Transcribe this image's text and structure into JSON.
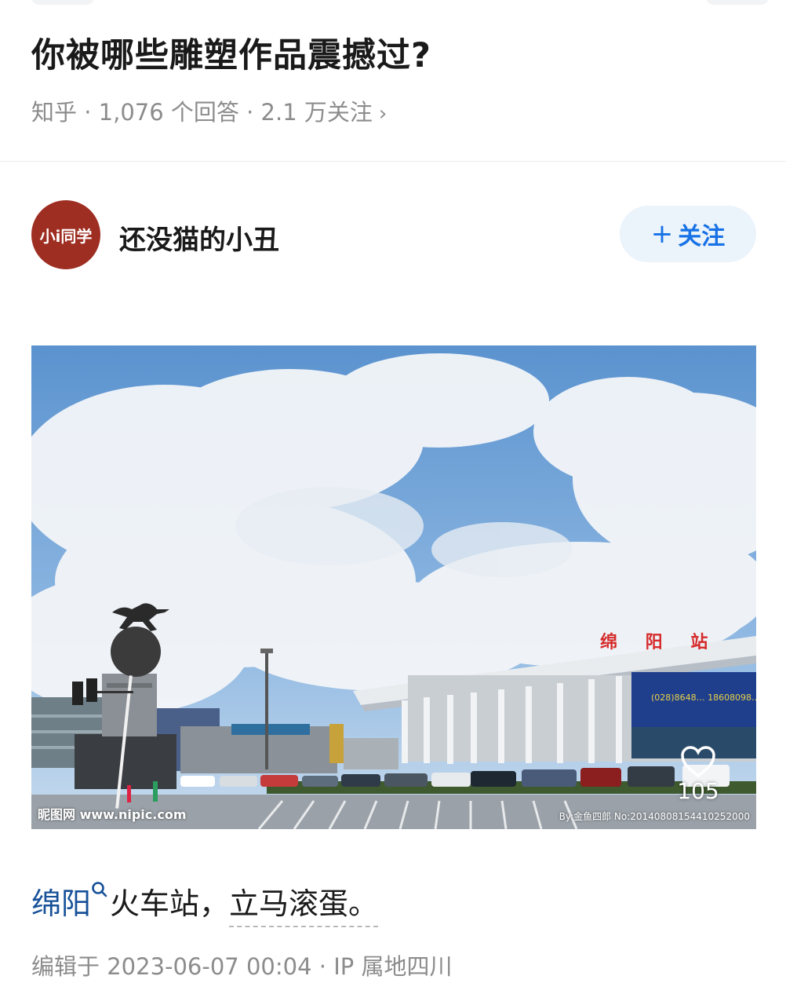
{
  "question": {
    "title": "你被哪些雕塑作品震撼过?",
    "meta": "知乎 · 1,076 个回答 · 2.1 万关注",
    "chevron": "›"
  },
  "author": {
    "avatar_text": "小i同学",
    "name": "还没猫的小丑",
    "follow_icon": "+",
    "follow_label": "关注"
  },
  "photo": {
    "station_sign": "绵 阳 站",
    "screen_text": "(028)8648… 18608098…",
    "like_count": "105",
    "watermark_left": "昵图网 www.nipic.com",
    "watermark_right": "By:金鱼四郎 No:20140808154410252000"
  },
  "answer": {
    "keyword": "绵阳",
    "text_mid": "火车站，",
    "text_end": "立马滚蛋。",
    "edit_meta": "编辑于 2023-06-07 00:04 · IP 属地四川"
  },
  "colors": {
    "accent": "#1772e6",
    "keyword": "#175199",
    "avatar_bg": "#9e2e22",
    "meta_gray": "#8c8c8c"
  }
}
